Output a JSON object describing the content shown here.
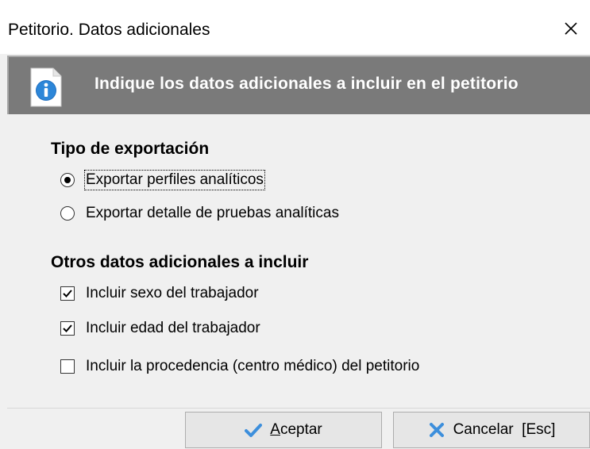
{
  "window": {
    "title": "Petitorio. Datos adicionales"
  },
  "header": {
    "text": "Indique los datos adicionales a incluir en el petitorio"
  },
  "export_section": {
    "title": "Tipo de exportación",
    "options": [
      {
        "label": "Exportar perfiles analíticos",
        "selected": true
      },
      {
        "label": "Exportar detalle de pruebas analíticas",
        "selected": false
      }
    ]
  },
  "other_section": {
    "title": "Otros datos adicionales a incluir",
    "options": [
      {
        "label": "Incluir sexo del trabajador",
        "checked": true
      },
      {
        "label": "Incluir edad del trabajador",
        "checked": true
      },
      {
        "label": "Incluir la procedencia (centro médico) del petitorio",
        "checked": false
      }
    ]
  },
  "buttons": {
    "accept_mnemonic": "A",
    "accept_rest": "ceptar",
    "cancel_label": "Cancelar  [Esc]"
  },
  "icons": {
    "close": "close-icon",
    "info": "info-icon",
    "accept": "checkmark-icon",
    "cancel": "cross-icon"
  },
  "colors": {
    "header_band": "#7a7a7a",
    "header_text": "#ffffff",
    "accept_check": "#3d8fdc",
    "cancel_cross": "#3d8fdc"
  }
}
